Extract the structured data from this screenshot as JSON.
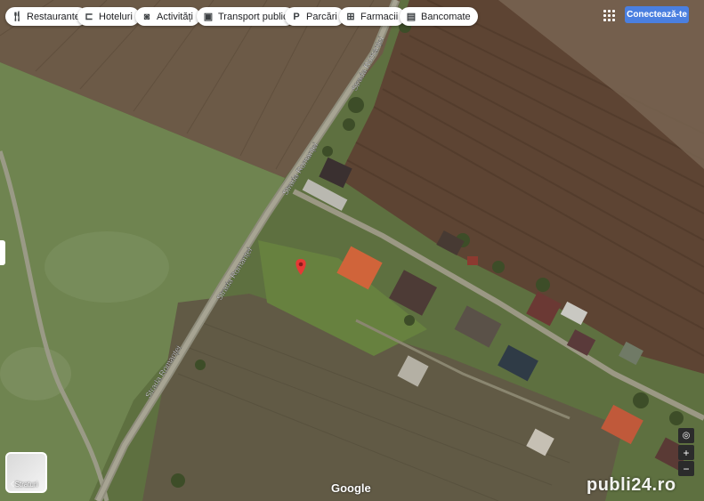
{
  "toolbar": {
    "chips": [
      {
        "label": "Restaurante",
        "icon": "fork-knife-icon"
      },
      {
        "label": "Hoteluri",
        "icon": "bed-icon"
      },
      {
        "label": "Activități",
        "icon": "camera-icon"
      },
      {
        "label": "Transport public",
        "icon": "bus-icon"
      },
      {
        "label": "Parcări",
        "icon": "parking-icon"
      },
      {
        "label": "Farmacii",
        "icon": "pharmacy-icon"
      },
      {
        "label": "Bancomate",
        "icon": "atm-icon"
      }
    ],
    "apps_icon": "apps-grid-icon",
    "signin_label": "Conectează-te"
  },
  "map": {
    "street_labels": [
      "Strada Romanței",
      "Strada Romanței",
      "Strada Romanței",
      "Strada Romanței"
    ],
    "marker_icon": "location-pin-icon",
    "marker_color": "#e53935"
  },
  "layers": {
    "label": "Straturi",
    "icon": "layers-icon"
  },
  "controls": {
    "locate_icon": "locate-icon",
    "zoom_in": "+",
    "zoom_out": "−"
  },
  "attribution": {
    "google": "Google"
  },
  "watermark": "publi24.ro"
}
